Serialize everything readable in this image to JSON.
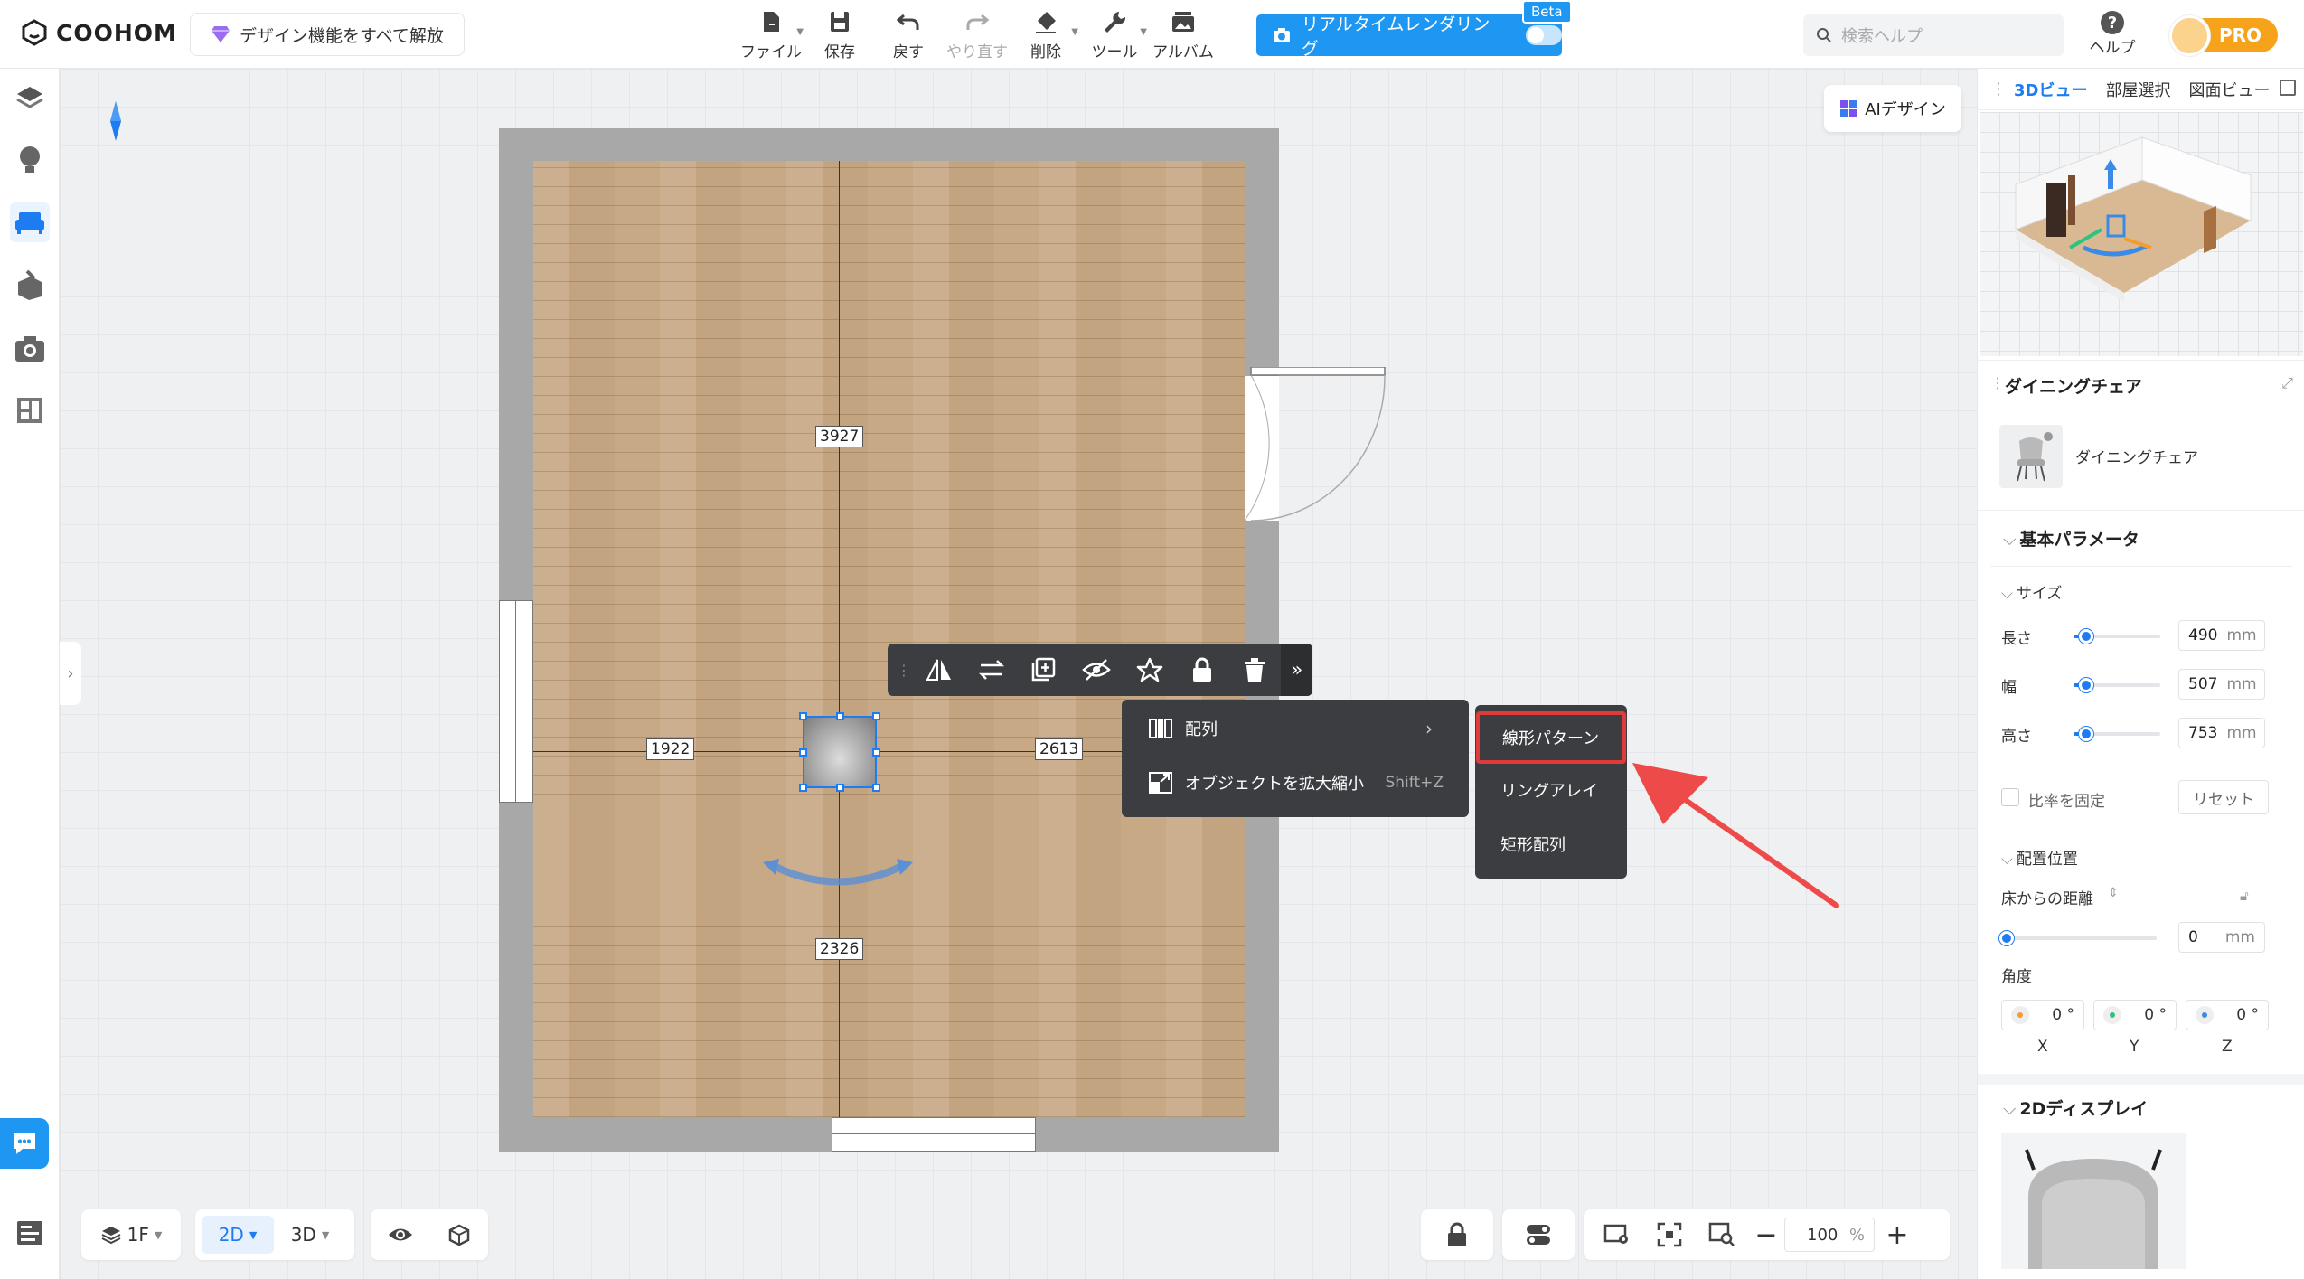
{
  "app": {
    "logo": "COOHOM",
    "unlock_label": "デザイン機能をすべて解放"
  },
  "toolbar": {
    "file": "ファイル",
    "save": "保存",
    "undo": "戻す",
    "redo": "やり直す",
    "delete": "削除",
    "tools": "ツール",
    "album": "アルバム"
  },
  "render": {
    "label": "リアルタイムレンダリング",
    "beta": "Beta"
  },
  "search": {
    "placeholder": "検索ヘルプ"
  },
  "help": {
    "label": "ヘルプ"
  },
  "account": {
    "badge": "PRO"
  },
  "canvas": {
    "ai_button": "AIデザイン",
    "dims": {
      "top": "3927",
      "left": "1922",
      "right": "2613",
      "bottom": "2326"
    }
  },
  "context_menu": {
    "array": "配列",
    "scale": "オブジェクトを拡大縮小",
    "scale_shortcut": "Shift+Z",
    "submenu": [
      "線形パターン",
      "リングアレイ",
      "矩形配列"
    ]
  },
  "bottom": {
    "floor": "1F",
    "mode_2d": "2D",
    "mode_3d": "3D",
    "zoom": "100",
    "zoom_unit": "%"
  },
  "panel": {
    "tabs": [
      "3Dビュー",
      "部屋選択",
      "図面ビュー"
    ],
    "object_title": "ダイニングチェア",
    "object_name": "ダイニングチェア",
    "basic_params": "基本パラメータ",
    "size": "サイズ",
    "length": {
      "label": "長さ",
      "value": "490",
      "unit": "mm"
    },
    "width": {
      "label": "幅",
      "value": "507",
      "unit": "mm"
    },
    "height": {
      "label": "高さ",
      "value": "753",
      "unit": "mm"
    },
    "lock_ratio": "比率を固定",
    "reset": "リセット",
    "placement": "配置位置",
    "floor_distance": {
      "label": "床からの距離",
      "value": "0",
      "unit": "mm"
    },
    "angle": {
      "label": "角度",
      "x": "0 °",
      "y": "0 °",
      "z": "0 °",
      "x_label": "X",
      "y_label": "Y",
      "z_label": "Z"
    },
    "display_2d": "2Dディスプレイ"
  }
}
